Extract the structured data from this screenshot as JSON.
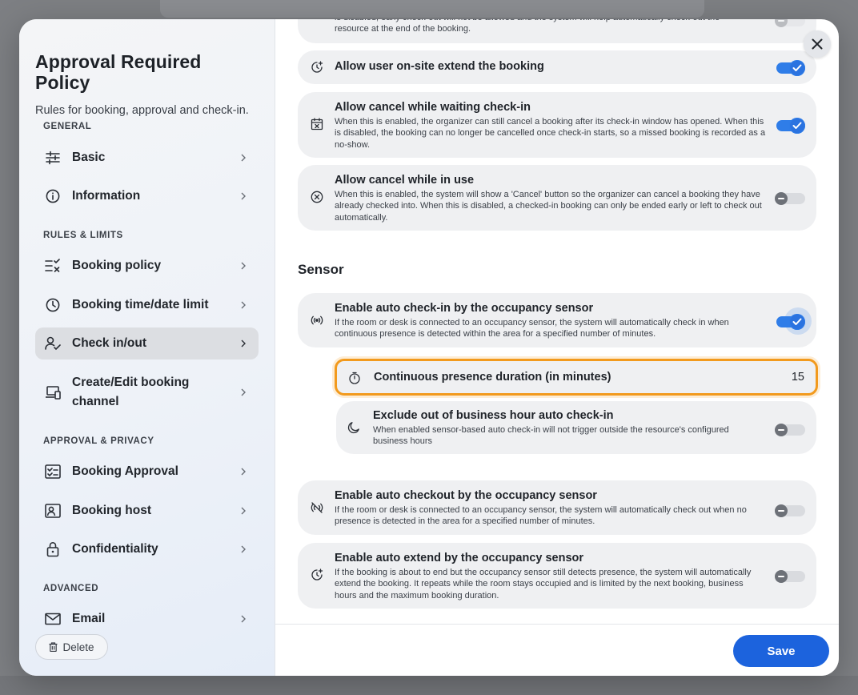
{
  "modal": {
    "title": "Approval Required Policy",
    "subtitle": "Rules for booking, approval and check-in."
  },
  "sidebar": {
    "sections": {
      "general": "GENERAL",
      "rules": "RULES & LIMITS",
      "approval": "APPROVAL & PRIVACY",
      "advanced": "ADVANCED"
    },
    "items": [
      {
        "label": "Basic",
        "icon": "sliders-icon"
      },
      {
        "label": "Information",
        "icon": "info-icon"
      },
      {
        "label": "Booking policy",
        "icon": "rules-list-icon"
      },
      {
        "label": "Booking time/date limit",
        "icon": "clock-icon"
      },
      {
        "label": "Check in/out",
        "icon": "user-check-icon",
        "active": true
      },
      {
        "label": "Create/Edit booking channel",
        "icon": "devices-icon"
      },
      {
        "label": "Booking Approval",
        "icon": "approval-list-icon"
      },
      {
        "label": "Booking host",
        "icon": "host-card-icon"
      },
      {
        "label": "Confidentiality",
        "icon": "lock-icon"
      },
      {
        "label": "Email",
        "icon": "mail-icon"
      }
    ],
    "delete_label": "Delete"
  },
  "main": {
    "top_card_desc": "is disabled, early check-out will not be allowed and the system will help automatically check-out the resource at the end of the booking.",
    "cards": [
      {
        "title": "Allow user on-site extend the booking",
        "desc": "",
        "on": true
      },
      {
        "title": "Allow cancel while waiting check-in",
        "desc": "When this is enabled, the organizer can still cancel a booking after its check-in window has opened. When this is disabled, the booking can no longer be cancelled once check-in starts, so a missed booking is recorded as a no-show.",
        "on": true
      },
      {
        "title": "Allow cancel while in use",
        "desc": "When this is enabled, the system will show a 'Cancel' button so the organizer can cancel a booking they have already checked into. When this is disabled, a checked-in booking can only be ended early or left to check out automatically.",
        "on": false
      }
    ],
    "sensor_title": "Sensor",
    "sensor_cards": [
      {
        "title": "Enable auto check-in by the occupancy sensor",
        "desc": "If the room or desk is connected to an occupancy sensor, the system will automatically check in when continuous presence is detected within the area for a specified number of minutes.",
        "on": true
      },
      {
        "title": "Exclude out of business hour auto check-in",
        "desc": "When enabled sensor-based auto check-in will not trigger outside the resource's configured business hours",
        "on": false
      },
      {
        "title": "Enable auto checkout by the occupancy sensor",
        "desc": "If the room or desk is connected to an occupancy sensor, the system will automatically check out when no presence is detected in the area for a specified number of minutes.",
        "on": false
      },
      {
        "title": "Enable auto extend by the occupancy sensor",
        "desc": "If the booking is about to end but the occupancy sensor still detects presence, the system will automatically extend the booking. It repeats while the room stays occupied and is limited by the next booking, business hours and the maximum booking duration.",
        "on": false
      }
    ],
    "duration": {
      "label": "Continuous presence duration (in minutes)",
      "value": "15"
    }
  },
  "footer": {
    "save_label": "Save"
  },
  "colors": {
    "accent": "#1c63dd",
    "toggle_on": "#2f7de8",
    "focus_outline": "#f29a1d",
    "card_bg": "#eff0f2"
  }
}
